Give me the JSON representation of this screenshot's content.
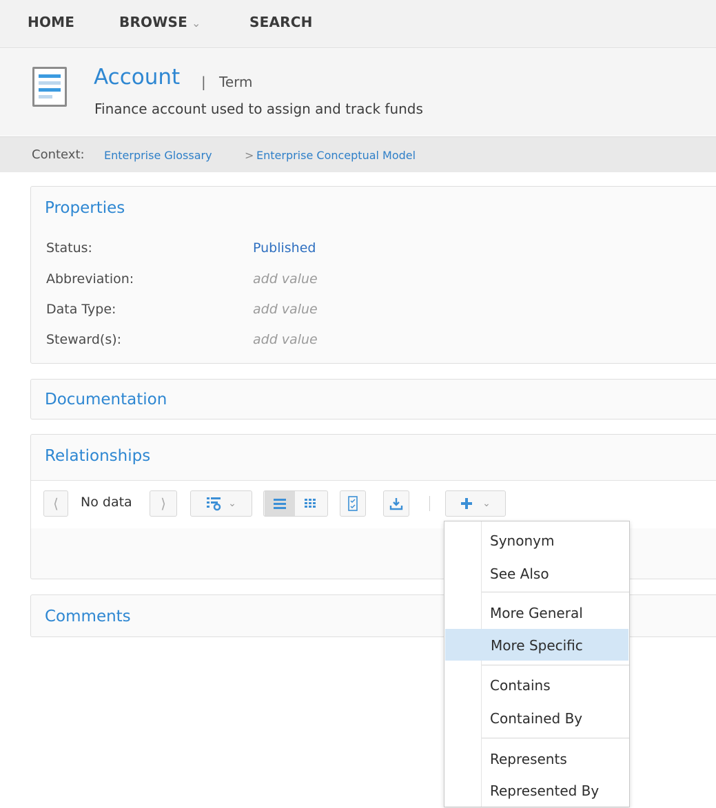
{
  "nav": {
    "items": [
      "HOME",
      "BROWSE",
      "SEARCH"
    ],
    "browse_chevron": "chevron-down-icon"
  },
  "header": {
    "title": "Account",
    "separator": "|",
    "type": "Term",
    "description": "Finance account used to assign and track funds",
    "icon": "document-icon"
  },
  "context": {
    "label": "Context:",
    "crumbs": [
      "Enterprise Glossary",
      "Enterprise Conceptual Model"
    ],
    "separator": ">"
  },
  "properties": {
    "title": "Properties",
    "rows": [
      {
        "label": "Status:",
        "value": "Published",
        "empty": false
      },
      {
        "label": "Abbreviation:",
        "value": "add value",
        "empty": true
      },
      {
        "label": "Data Type:",
        "value": "add value",
        "empty": true
      },
      {
        "label": "Steward(s):",
        "value": "add value",
        "empty": true
      }
    ]
  },
  "documentation": {
    "title": "Documentation"
  },
  "relationships": {
    "title": "Relationships",
    "toolbar": {
      "pager_text": "No data",
      "icons": [
        "chevron-left-icon",
        "chevron-right-icon",
        "column-settings-icon",
        "list-view-icon",
        "grid-view-icon",
        "checklist-icon",
        "export-icon",
        "add-icon"
      ]
    }
  },
  "comments": {
    "title": "Comments"
  },
  "add_menu": {
    "groups": [
      [
        "Synonym",
        "See Also"
      ],
      [
        "More General",
        "More Specific"
      ],
      [
        "Contains",
        "Contained By"
      ],
      [
        "Represents",
        "Represented By"
      ]
    ],
    "highlighted": "More Specific"
  },
  "colors": {
    "accent": "#2e87d2",
    "highlight": "#d3e6f6",
    "nav_bg": "#f2f2f2"
  }
}
